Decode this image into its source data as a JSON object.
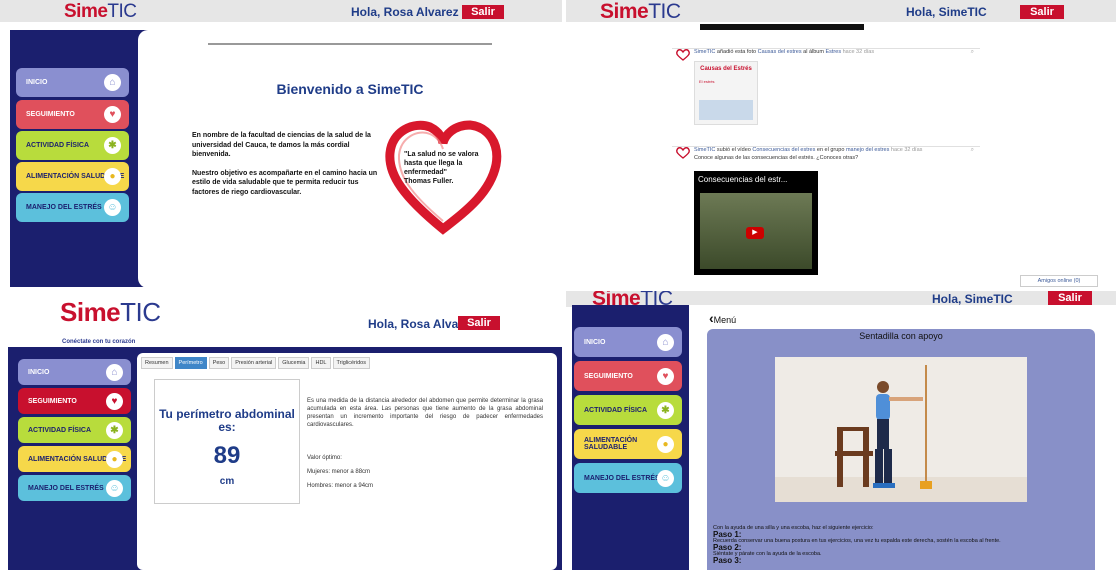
{
  "colors": {
    "red": "#c8102e",
    "navy": "#1b1f6e",
    "blue": "#1f3c88"
  },
  "brand": {
    "part1": "Sime",
    "part2": "TIC",
    "tagline": "Conéctate con tu corazón"
  },
  "menu": [
    {
      "label": "INICIO",
      "icon": "home-icon",
      "color": "#8a8fd0"
    },
    {
      "label": "SEGUIMIENTO",
      "icon": "heart-icon",
      "color": "#e0505c"
    },
    {
      "label": "ACTIVIDAD FÍSICA",
      "icon": "runner-icon",
      "color": "#b8dc3c"
    },
    {
      "label": "ALIMENTACIÓN SALUDABLE",
      "icon": "apple-icon",
      "color": "#f6d84a"
    },
    {
      "label": "MANEJO DEL ESTRÉS",
      "icon": "smile-icon",
      "color": "#5cc0dc"
    }
  ],
  "q1": {
    "greeting": "Hola, Rosa Alvarez",
    "logout": "Salir",
    "welcome": "Bienvenido a SimeTIC",
    "intro1": "En nombre de la facultad de ciencias de la salud de la universidad del Cauca, te damos la más cordial bienvenida.",
    "intro2": "Nuestro objetivo es acompañarte en el camino hacia un estilo de vida saludable que te permita reducir tus factores de riego cardiovascular.",
    "quote": "\"La salud no se valora hasta que llega la enfermedad\"",
    "quote_author": "Thomas Fuller."
  },
  "q2": {
    "greeting": "Hola, SimeTIC",
    "logout": "Salir",
    "post1": {
      "user": "SimeTIC",
      "text1": " añadió esta foto ",
      "link1": "Causas del estres",
      "text2": " al álbum ",
      "link2": "Estres",
      "time": " hace 32 días",
      "thumb_title": "Causas del Estrés",
      "thumb_sub": "El estrés"
    },
    "post2": {
      "user": "SimeTIC",
      "text1": " subió el vídeo ",
      "link1": "Consecuencias del estres",
      "text2": " en el grupo ",
      "link2": "manejo del estres",
      "time": " hace 32 días",
      "caption": "Conoce algunas de las consecuencias del estrés. ¿Conoces otras?",
      "video_title": "Consecuencias del estr..."
    },
    "amigos": "Amigos online (0)"
  },
  "q3": {
    "greeting": "Hola, Rosa Alvarez",
    "logout": "Salir",
    "tabs": [
      "Resumen",
      "Perímetro",
      "Peso",
      "Presión arterial",
      "Glucemia",
      "HDL",
      "Triglicéridos"
    ],
    "active_tab": 1,
    "box_title": "Tu perímetro abdominal es:",
    "value": "89",
    "unit": "cm",
    "description": "Es una medida de la distancia alrededor del abdomen que permite determinar la grasa acumulada en esta área. Las personas que tiene aumento de la grasa abdominal presentan un incremento importante del riesgo de padecer enfermedades cardiovasculares.",
    "optimal_label": "Valor óptimo:",
    "women": "Mujeres: menor a 88cm",
    "men": "Hombres: menor a 94cm"
  },
  "q4": {
    "greeting": "Hola, SimeTIC",
    "logout": "Salir",
    "back": "Menú",
    "title": "Sentadilla con apoyo",
    "instruction": "Con la ayuda de una silla y una escoba, haz el siguiente ejercicio:",
    "step1_title": "Paso 1:",
    "step1_text": "Recuerda conservar una buena postura en tus ejercicios, una vez tu espalda este derecha, sostén la escoba al frente.",
    "step2_title": "Paso 2:",
    "step2_text": "Siéntate y párate con la ayuda de la escoba.",
    "step3_title": "Paso 3:"
  }
}
